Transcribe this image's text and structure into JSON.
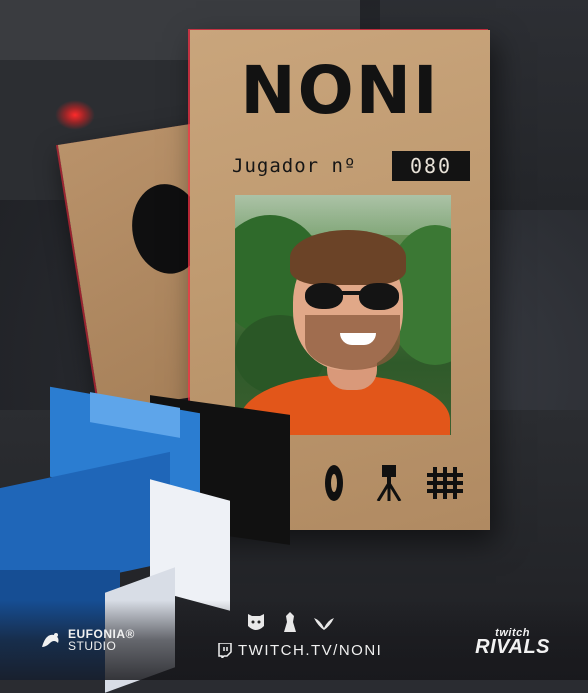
{
  "card": {
    "name": "NONI",
    "label": "Jugador nº",
    "number": "080"
  },
  "symbols": [
    "circle-zero-icon",
    "tripod-icon",
    "hash-icon"
  ],
  "footer": {
    "studio_brand": "EUFONIA®",
    "studio_sub": "STUDIO",
    "twitch_url": "TWITCH.TV/NONI",
    "rivals_top": "twitch",
    "rivals_bottom": "RIVALS"
  },
  "colors": {
    "card": "#c9a57c",
    "ink": "#121212",
    "accent_red": "#ff2a2a",
    "arm_blue": "#2b7dd1",
    "shirt_orange": "#e2561a"
  }
}
